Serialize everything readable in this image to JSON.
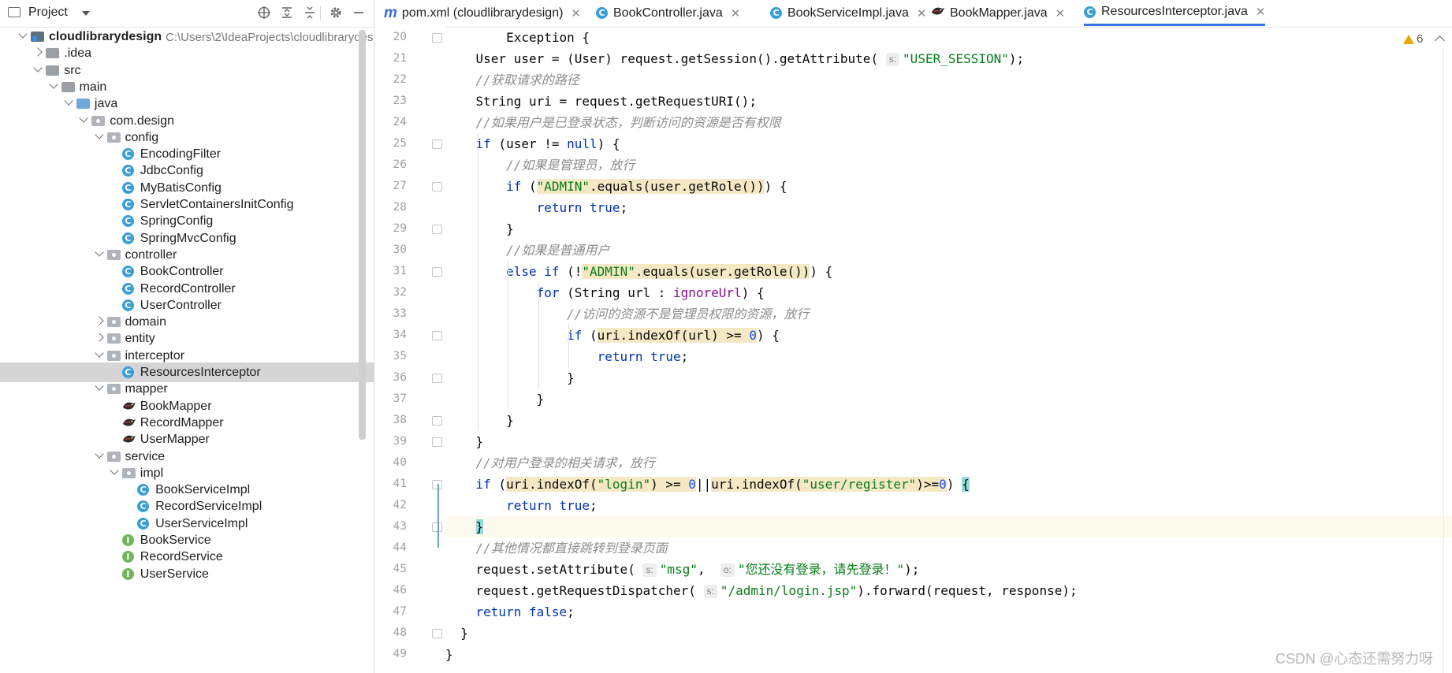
{
  "project_panel": {
    "title": "Project",
    "toolbar_icons": [
      "crosshair-icon",
      "expand-all-icon",
      "collapse-all-icon",
      "gear-icon",
      "minimize-icon"
    ],
    "tree": [
      {
        "label": "cloudlibrarydesign",
        "path": "C:\\Users\\2\\IdeaProjects\\cloudlibrarydes",
        "depth": 0,
        "chevron": "open",
        "icon": "module",
        "bold": true
      },
      {
        "label": ".idea",
        "depth": 1,
        "chevron": "closed",
        "icon": "folder-grey"
      },
      {
        "label": "src",
        "depth": 1,
        "chevron": "open",
        "icon": "folder-grey"
      },
      {
        "label": "main",
        "depth": 2,
        "chevron": "open",
        "icon": "folder-grey"
      },
      {
        "label": "java",
        "depth": 3,
        "chevron": "open",
        "icon": "folder-blue"
      },
      {
        "label": "com.design",
        "depth": 4,
        "chevron": "open",
        "icon": "package"
      },
      {
        "label": "config",
        "depth": 5,
        "chevron": "open",
        "icon": "package"
      },
      {
        "label": "EncodingFilter",
        "depth": 6,
        "icon": "class"
      },
      {
        "label": "JdbcConfig",
        "depth": 6,
        "icon": "class"
      },
      {
        "label": "MyBatisConfig",
        "depth": 6,
        "icon": "class"
      },
      {
        "label": "ServletContainersInitConfig",
        "depth": 6,
        "icon": "class"
      },
      {
        "label": "SpringConfig",
        "depth": 6,
        "icon": "class"
      },
      {
        "label": "SpringMvcConfig",
        "depth": 6,
        "icon": "class"
      },
      {
        "label": "controller",
        "depth": 5,
        "chevron": "open",
        "icon": "package"
      },
      {
        "label": "BookController",
        "depth": 6,
        "icon": "class"
      },
      {
        "label": "RecordController",
        "depth": 6,
        "icon": "class"
      },
      {
        "label": "UserController",
        "depth": 6,
        "icon": "class"
      },
      {
        "label": "domain",
        "depth": 5,
        "chevron": "closed",
        "icon": "package"
      },
      {
        "label": "entity",
        "depth": 5,
        "chevron": "closed",
        "icon": "package"
      },
      {
        "label": "interceptor",
        "depth": 5,
        "chevron": "open",
        "icon": "package"
      },
      {
        "label": "ResourcesInterceptor",
        "depth": 6,
        "icon": "class",
        "selected": true
      },
      {
        "label": "mapper",
        "depth": 5,
        "chevron": "open",
        "icon": "package"
      },
      {
        "label": "BookMapper",
        "depth": 6,
        "icon": "mybatis"
      },
      {
        "label": "RecordMapper",
        "depth": 6,
        "icon": "mybatis"
      },
      {
        "label": "UserMapper",
        "depth": 6,
        "icon": "mybatis"
      },
      {
        "label": "service",
        "depth": 5,
        "chevron": "open",
        "icon": "package"
      },
      {
        "label": "impl",
        "depth": 6,
        "chevron": "open",
        "icon": "package"
      },
      {
        "label": "BookServiceImpl",
        "depth": 7,
        "icon": "class"
      },
      {
        "label": "RecordServiceImpl",
        "depth": 7,
        "icon": "class"
      },
      {
        "label": "UserServiceImpl",
        "depth": 7,
        "icon": "class"
      },
      {
        "label": "BookService",
        "depth": 6,
        "icon": "interface"
      },
      {
        "label": "RecordService",
        "depth": 6,
        "icon": "interface"
      },
      {
        "label": "UserService",
        "depth": 6,
        "icon": "interface"
      }
    ]
  },
  "tabs": [
    {
      "label": "pom.xml (cloudlibrarydesign)",
      "icon": "maven",
      "active": false
    },
    {
      "label": "BookController.java",
      "icon": "class",
      "active": false
    },
    {
      "label": "BookServiceImpl.java",
      "icon": "class",
      "active": false
    },
    {
      "label": "BookMapper.java",
      "icon": "mybatis",
      "active": false
    },
    {
      "label": "ResourcesInterceptor.java",
      "icon": "class",
      "active": true
    }
  ],
  "editor": {
    "warning_count": "6",
    "current_line": 43,
    "lines": [
      {
        "n": 20,
        "indent": 0,
        "tokens": [
          [
            "",
            "        Exception {"
          ]
        ]
      },
      {
        "n": 21,
        "indent": 0,
        "tokens": [
          [
            "",
            "    User user = (User) request.getSession().getAttribute( "
          ],
          [
            "hint",
            "s:"
          ],
          [
            "str",
            "\"USER_SESSION\""
          ],
          [
            "",
            ");"
          ]
        ]
      },
      {
        "n": 22,
        "indent": 0,
        "tokens": [
          [
            "cm",
            "    //获取请求的路径"
          ]
        ]
      },
      {
        "n": 23,
        "indent": 0,
        "tokens": [
          [
            "",
            "    String uri = request.getRequestURI();"
          ]
        ]
      },
      {
        "n": 24,
        "indent": 0,
        "tokens": [
          [
            "cm",
            "    //如果用户是已登录状态，判断访问的资源是否有权限"
          ]
        ]
      },
      {
        "n": 25,
        "indent": 0,
        "tokens": [
          [
            "kw",
            "    if"
          ],
          [
            "",
            " (user != "
          ],
          [
            "kw",
            "null"
          ],
          [
            "",
            ") {"
          ]
        ]
      },
      {
        "n": 26,
        "indent": 0,
        "tokens": [
          [
            "cm",
            "        //如果是管理员，放行"
          ]
        ]
      },
      {
        "n": 27,
        "indent": 0,
        "tokens": [
          [
            "kw",
            "        if"
          ],
          [
            "",
            " ("
          ],
          [
            "hlstr",
            "\"ADMIN\""
          ],
          [
            "hl",
            ".equals(user.getRole())"
          ],
          [
            "",
            ") {"
          ]
        ]
      },
      {
        "n": 28,
        "indent": 0,
        "tokens": [
          [
            "kw",
            "            return true"
          ],
          [
            "",
            ";"
          ]
        ]
      },
      {
        "n": 29,
        "indent": 0,
        "tokens": [
          [
            "",
            "        }"
          ]
        ]
      },
      {
        "n": 30,
        "indent": 0,
        "tokens": [
          [
            "cm",
            "        //如果是普通用户"
          ]
        ]
      },
      {
        "n": 31,
        "indent": 0,
        "tokens": [
          [
            "kw",
            "        else if"
          ],
          [
            "",
            " (!"
          ],
          [
            "hlstr",
            "\"ADMIN\""
          ],
          [
            "hl",
            ".equals(user.getRole())"
          ],
          [
            "",
            ") {"
          ]
        ]
      },
      {
        "n": 32,
        "indent": 0,
        "tokens": [
          [
            "kw",
            "            for"
          ],
          [
            "",
            " (String url : "
          ],
          [
            "fld",
            "ignoreUrl"
          ],
          [
            "",
            ") {"
          ]
        ]
      },
      {
        "n": 33,
        "indent": 0,
        "tokens": [
          [
            "cm",
            "                //访问的资源不是管理员权限的资源，放行"
          ]
        ]
      },
      {
        "n": 34,
        "indent": 0,
        "tokens": [
          [
            "kw",
            "                if"
          ],
          [
            "",
            " ("
          ],
          [
            "hl",
            "uri.indexOf(url) >= "
          ],
          [
            "hlnum",
            "0"
          ],
          [
            "",
            ") {"
          ]
        ]
      },
      {
        "n": 35,
        "indent": 0,
        "tokens": [
          [
            "kw",
            "                    return true"
          ],
          [
            "",
            ";"
          ]
        ]
      },
      {
        "n": 36,
        "indent": 0,
        "tokens": [
          [
            "",
            "                }"
          ]
        ]
      },
      {
        "n": 37,
        "indent": 0,
        "tokens": [
          [
            "",
            "            }"
          ]
        ]
      },
      {
        "n": 38,
        "indent": 0,
        "tokens": [
          [
            "",
            "        }"
          ]
        ]
      },
      {
        "n": 39,
        "indent": 0,
        "tokens": [
          [
            "",
            "    }"
          ]
        ]
      },
      {
        "n": 40,
        "indent": 0,
        "tokens": [
          [
            "cm",
            "    //对用户登录的相关请求，放行"
          ]
        ]
      },
      {
        "n": 41,
        "indent": 0,
        "tokens": [
          [
            "kw",
            "    if"
          ],
          [
            "",
            " ("
          ],
          [
            "hl",
            "uri.indexOf("
          ],
          [
            "hlstr",
            "\"login\""
          ],
          [
            "hl",
            ") >= "
          ],
          [
            "hlnum",
            "0"
          ],
          [
            "",
            "||"
          ],
          [
            "hl",
            "uri.indexOf("
          ],
          [
            "hlstr",
            "\"user/register\""
          ],
          [
            "hl",
            ")>="
          ],
          [
            "hlnum",
            "0"
          ],
          [
            "",
            ") "
          ],
          [
            "bm",
            "{"
          ]
        ]
      },
      {
        "n": 42,
        "indent": 0,
        "tokens": [
          [
            "kw",
            "        return true"
          ],
          [
            "",
            ";"
          ]
        ]
      },
      {
        "n": 43,
        "indent": 0,
        "tokens": [
          [
            "",
            "    "
          ],
          [
            "bm",
            "}"
          ]
        ]
      },
      {
        "n": 44,
        "indent": 0,
        "tokens": [
          [
            "cm",
            "    //其他情况都直接跳转到登录页面"
          ]
        ]
      },
      {
        "n": 45,
        "indent": 0,
        "tokens": [
          [
            "",
            "    request.setAttribute( "
          ],
          [
            "hint",
            "s:"
          ],
          [
            "str",
            "\"msg\""
          ],
          [
            "",
            ",  "
          ],
          [
            "hint",
            "o:"
          ],
          [
            "str",
            "\"您还没有登录，请先登录！\""
          ],
          [
            "",
            ");"
          ]
        ]
      },
      {
        "n": 46,
        "indent": 0,
        "tokens": [
          [
            "",
            "    request.getRequestDispatcher( "
          ],
          [
            "hint",
            "s:"
          ],
          [
            "str",
            "\"/admin/login.jsp\""
          ],
          [
            "",
            ").forward(request, response);"
          ]
        ]
      },
      {
        "n": 47,
        "indent": 0,
        "tokens": [
          [
            "kw",
            "    return false"
          ],
          [
            "",
            ";"
          ]
        ]
      },
      {
        "n": 48,
        "indent": 0,
        "tokens": [
          [
            "",
            "  }"
          ]
        ]
      },
      {
        "n": 49,
        "indent": 0,
        "tokens": [
          [
            "",
            "}"
          ]
        ]
      }
    ]
  },
  "watermark": "CSDN @心态还需努力呀",
  "colors": {
    "accent": "#3574f0",
    "keyword": "#0033b3",
    "string": "#067d17",
    "number": "#1750eb",
    "comment": "#8c8c8c",
    "field": "#871094",
    "selection": "#d5d5d5"
  }
}
